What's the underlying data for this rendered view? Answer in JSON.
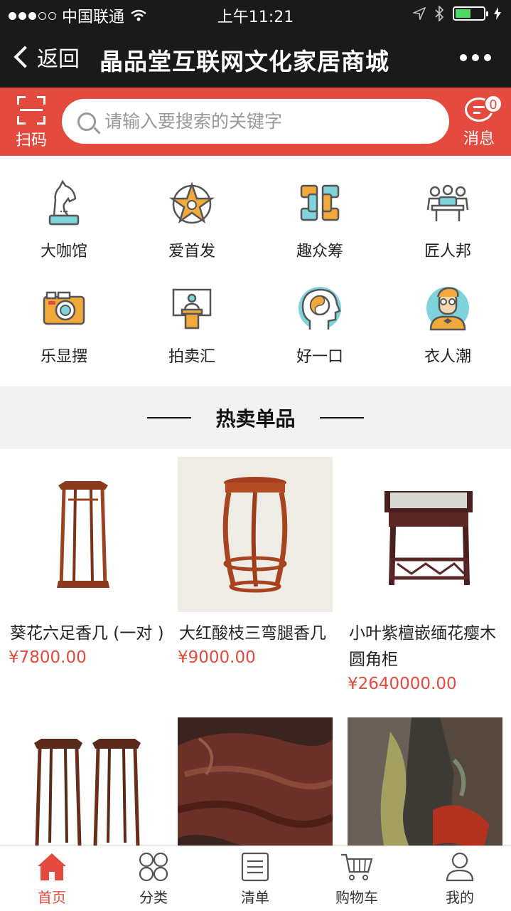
{
  "status_bar": {
    "carrier": "中国联通",
    "time": "上午11:21"
  },
  "nav": {
    "back_label": "返回",
    "title": "晶品堂互联网文化家居商城"
  },
  "search": {
    "scan_label": "扫码",
    "placeholder": "请输入要搜索的关键字",
    "message_label": "消息",
    "message_count": "0"
  },
  "categories": [
    {
      "label": "大咖馆",
      "icon": "chess-knight-icon"
    },
    {
      "label": "爱首发",
      "icon": "star-badge-icon"
    },
    {
      "label": "趣众筹",
      "icon": "linked-hands-icon"
    },
    {
      "label": "匠人邦",
      "icon": "meeting-table-icon"
    },
    {
      "label": "乐显摆",
      "icon": "camera-icon"
    },
    {
      "label": "拍卖汇",
      "icon": "podium-speaker-icon"
    },
    {
      "label": "好一口",
      "icon": "head-yinyang-icon"
    },
    {
      "label": "衣人潮",
      "icon": "man-portrait-icon"
    }
  ],
  "section": {
    "title": "热卖单品"
  },
  "products": [
    {
      "name": "葵花六足香几 (一对 )",
      "price": "¥7800.00"
    },
    {
      "name": "大红酸枝三弯腿香几",
      "price": "¥9000.00"
    },
    {
      "name": "小叶紫檀嵌缅花瘿木圆角柜",
      "price": "¥2640000.00"
    },
    {
      "name": "",
      "price": ""
    },
    {
      "name": "",
      "price": ""
    },
    {
      "name": "",
      "price": ""
    }
  ],
  "tabs": [
    {
      "label": "首页",
      "icon": "home-icon",
      "active": true
    },
    {
      "label": "分类",
      "icon": "grid-circles-icon",
      "active": false
    },
    {
      "label": "清单",
      "icon": "list-icon",
      "active": false
    },
    {
      "label": "购物车",
      "icon": "cart-icon",
      "active": false
    },
    {
      "label": "我的",
      "icon": "user-icon",
      "active": false
    }
  ],
  "colors": {
    "accent": "#e44a3e",
    "nav_bg": "#1a1a1a"
  }
}
